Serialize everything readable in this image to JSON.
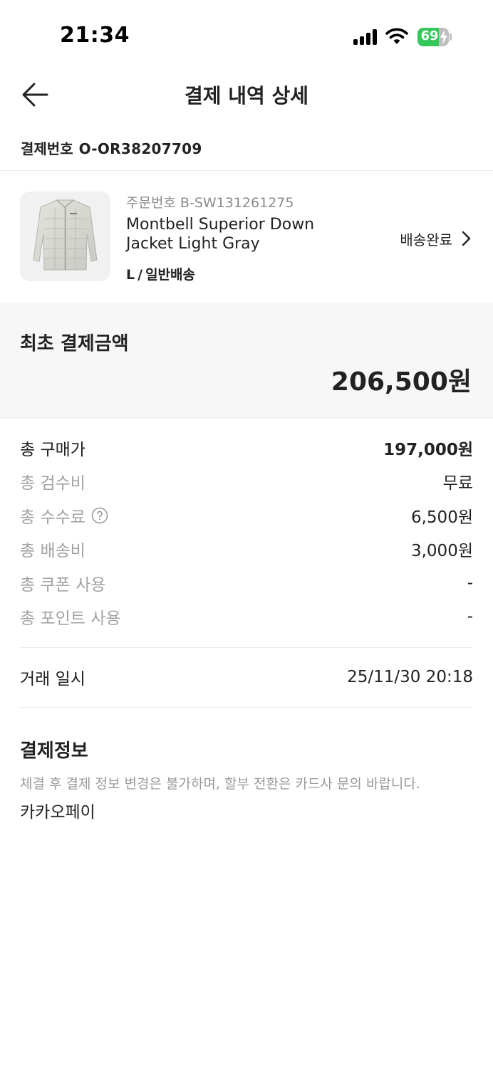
{
  "status_bar": {
    "time": "21:34",
    "battery": "69",
    "battery_level": 0.69,
    "battery_color": "#34c759"
  },
  "header": {
    "title": "결제 내역 상세"
  },
  "payment_number": {
    "label": "결제번호",
    "value": "O-OR38207709"
  },
  "product": {
    "order_label": "주문번호",
    "order_number": "B-SW131261275",
    "name": "Montbell Superior Down Jacket Light Gray",
    "size": "L",
    "option_sep": "/",
    "shipping_type": "일반배송",
    "status": "배송완료"
  },
  "summary": {
    "label": "최초 결제금액",
    "amount": "206,500원"
  },
  "breakdown": [
    {
      "label": "총 구매가",
      "value": "197,000원"
    },
    {
      "label": "총 검수비",
      "value": "무료"
    },
    {
      "label": "총 수수료",
      "value": "6,500원"
    },
    {
      "label": "총 배송비",
      "value": "3,000원"
    },
    {
      "label": "총 쿠폰 사용",
      "value": "-"
    },
    {
      "label": "총 포인트 사용",
      "value": "-"
    }
  ],
  "transaction": {
    "label": "거래 일시",
    "value": "25/11/30 20:18"
  },
  "payment_info": {
    "title": "결제정보",
    "notice": "체결 후 결제 정보 변경은 불가하며, 할부 전환은 카드사 문의 바랍니다.",
    "method": "카카오페이"
  }
}
